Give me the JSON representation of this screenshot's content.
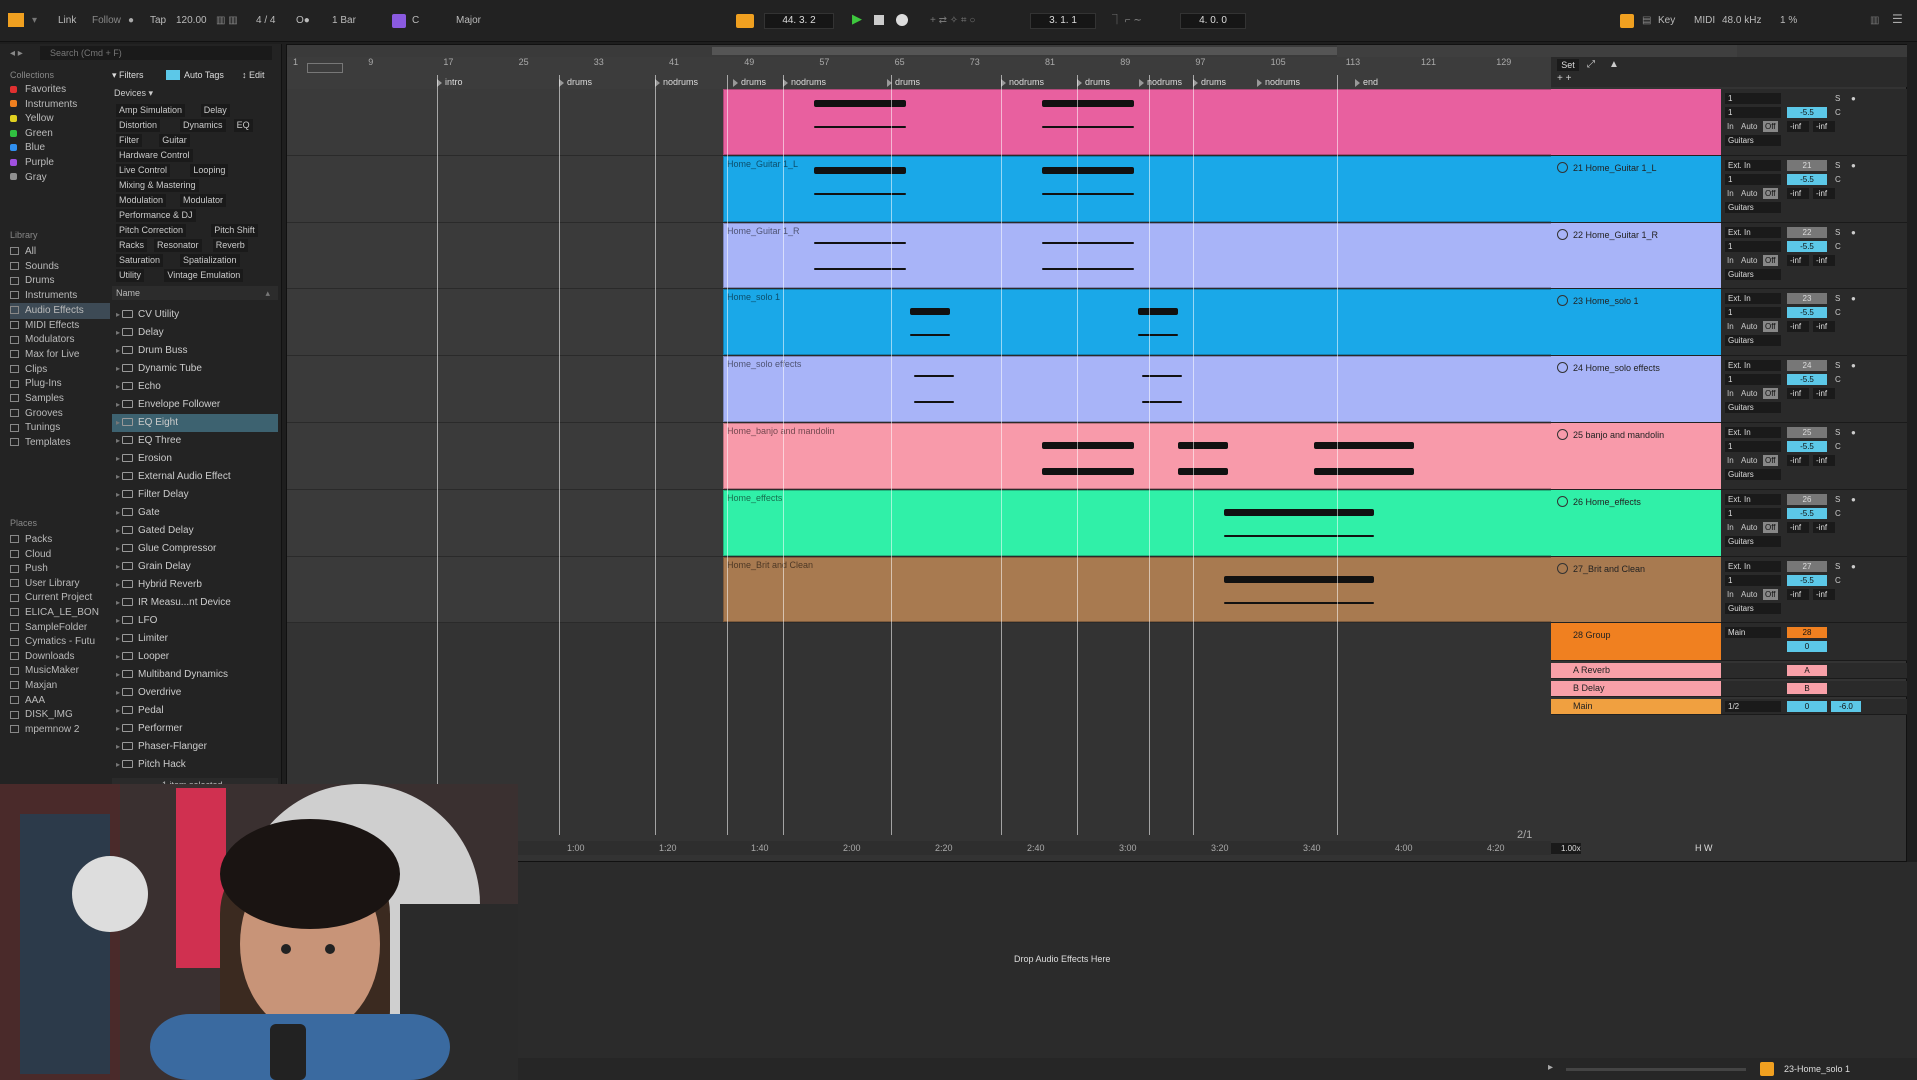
{
  "topbar": {
    "link": "Link",
    "follow": "Follow",
    "tap": "Tap",
    "tempo": "120.00",
    "signature": "4 / 4",
    "metronome": "O●",
    "quantize": "1 Bar",
    "key": "C",
    "scale": "Major",
    "position": "44.  3.  2",
    "loop_start": "3.  1.  1",
    "loop_length": "4.  0.  0",
    "key_label": "Key",
    "midi_label": "MIDI",
    "sample_rate": "48.0 kHz",
    "cpu": "1 %"
  },
  "browser": {
    "search_placeholder": "Search (Cmd + F)",
    "collections_label": "Collections",
    "collections": [
      {
        "name": "Favorites",
        "color": "#e03030"
      },
      {
        "name": "Instruments",
        "color": "#f08020"
      },
      {
        "name": "Yellow",
        "color": "#e0d020"
      },
      {
        "name": "Green",
        "color": "#30c040"
      },
      {
        "name": "Blue",
        "color": "#3090f0"
      },
      {
        "name": "Purple",
        "color": "#a050e0"
      },
      {
        "name": "Gray",
        "color": "#909090"
      }
    ],
    "library_label": "Library",
    "library": [
      "All",
      "Sounds",
      "Drums",
      "Instruments",
      "Audio Effects",
      "MIDI Effects",
      "Modulators",
      "Max for Live",
      "Clips",
      "Plug-Ins",
      "Samples",
      "Grooves",
      "Tunings",
      "Templates"
    ],
    "places_label": "Places",
    "places": [
      "Packs",
      "Cloud",
      "Push",
      "User Library",
      "Current Project",
      "ELICA_LE_BON",
      "SampleFolder",
      "Cymatics - Futu",
      "Downloads",
      "MusicMaker",
      "Maxjan",
      "AAA",
      "DISK_IMG",
      "mpemnow 2"
    ],
    "filters": "Filters",
    "auto_tags": "Auto Tags",
    "edit": "Edit",
    "devices_label": "Devices",
    "tags": [
      [
        "Amp Simulation",
        "Delay"
      ],
      [
        "Distortion",
        "Dynamics",
        "EQ"
      ],
      [
        "Filter",
        "Guitar"
      ],
      [
        "Hardware Control"
      ],
      [
        "Live Control",
        "Looping"
      ],
      [
        "Mixing & Mastering"
      ],
      [
        "Modulation",
        "Modulator"
      ],
      [
        "Performance & DJ"
      ],
      [
        "Pitch Correction",
        "Pitch Shift"
      ],
      [
        "Racks",
        "Resonator",
        "Reverb"
      ],
      [
        "Saturation",
        "Spatialization"
      ],
      [
        "Utility",
        "Vintage Emulation"
      ]
    ],
    "name_header": "Name",
    "devices": [
      "CV Utility",
      "Delay",
      "Drum Buss",
      "Dynamic Tube",
      "Echo",
      "Envelope Follower",
      "EQ Eight",
      "EQ Three",
      "Erosion",
      "External Audio Effect",
      "Filter Delay",
      "Gate",
      "Gated Delay",
      "Glue Compressor",
      "Grain Delay",
      "Hybrid Reverb",
      "IR Measu...nt Device",
      "LFO",
      "Limiter",
      "Looper",
      "Multiband Dynamics",
      "Overdrive",
      "Pedal",
      "Performer",
      "Phaser-Flanger",
      "Pitch Hack"
    ],
    "selected_device": "EQ Eight",
    "status": "1 item selected"
  },
  "arrangement": {
    "set_label": "Set",
    "bar_numbers": [
      "1",
      "9",
      "17",
      "25",
      "33",
      "41",
      "49",
      "57",
      "65",
      "73",
      "81",
      "89",
      "97",
      "105",
      "113",
      "121",
      "129"
    ],
    "locators": [
      "intro",
      "drums",
      "nodrums",
      "drums",
      "nodrums",
      "drums",
      "nodrums",
      "drums",
      "nodrums",
      "drums",
      "nodrums",
      "end"
    ],
    "time_labels": [
      "1:00",
      "1:20",
      "1:40",
      "2:00",
      "2:20",
      "2:40",
      "3:00",
      "3:20",
      "3:40",
      "4:00",
      "4:20"
    ],
    "page": "2/1",
    "zoom": "1.00x",
    "tracks": [
      {
        "clip": "",
        "header": "",
        "color": "#e8609f",
        "num": "",
        "input": "1",
        "monitor": "Guitars"
      },
      {
        "clip": "Home_Guitar 1_L",
        "header": "21 Home_Guitar 1_L",
        "color": "#1aa8e8",
        "num": "21",
        "input": "Ext. In",
        "monitor": "Guitars"
      },
      {
        "clip": "Home_Guitar 1_R",
        "header": "22 Home_Guitar 1_R",
        "color": "#a8b4f8",
        "num": "22",
        "input": "Ext. In",
        "monitor": "Guitars"
      },
      {
        "clip": "Home_solo 1",
        "header": "23 Home_solo 1",
        "color": "#1aa8e8",
        "num": "23",
        "input": "Ext. In",
        "monitor": "Guitars"
      },
      {
        "clip": "Home_solo effects",
        "header": "24 Home_solo effects",
        "color": "#a8b4f8",
        "num": "24",
        "input": "Ext. In",
        "monitor": "Guitars"
      },
      {
        "clip": "Home_banjo and mandolin",
        "header": "25 banjo and mandolin",
        "color": "#f89aaa",
        "num": "25",
        "input": "Ext. In",
        "monitor": "Guitars"
      },
      {
        "clip": "Home_effects",
        "header": "26 Home_effects",
        "color": "#30f0a8",
        "num": "26",
        "input": "Ext. In",
        "monitor": "Guitars"
      },
      {
        "clip": "Home_Brit and Clean",
        "header": "27_Brit and Clean",
        "color": "#a87a50",
        "num": "27",
        "input": "Ext. In",
        "monitor": "Guitars"
      }
    ],
    "group": {
      "name": "28 Group",
      "output": "Main",
      "num": "28",
      "vol": "0"
    },
    "returns": [
      {
        "name": "A Reverb",
        "letter": "A",
        "color": "#f8a0a8"
      },
      {
        "name": "B Delay",
        "letter": "B",
        "color": "#f8a0a8"
      }
    ],
    "main": {
      "name": "Main",
      "ratio": "1/2",
      "vol": "0",
      "db": "-6.0"
    },
    "auto": "Auto",
    "off": "Off",
    "in": "In",
    "vol": "-5.5",
    "sends": "-inf",
    "s": "S",
    "c": "C"
  },
  "detail": {
    "drop_text": "Drop Audio Effects Here",
    "track_name": "23-Home_solo 1"
  }
}
